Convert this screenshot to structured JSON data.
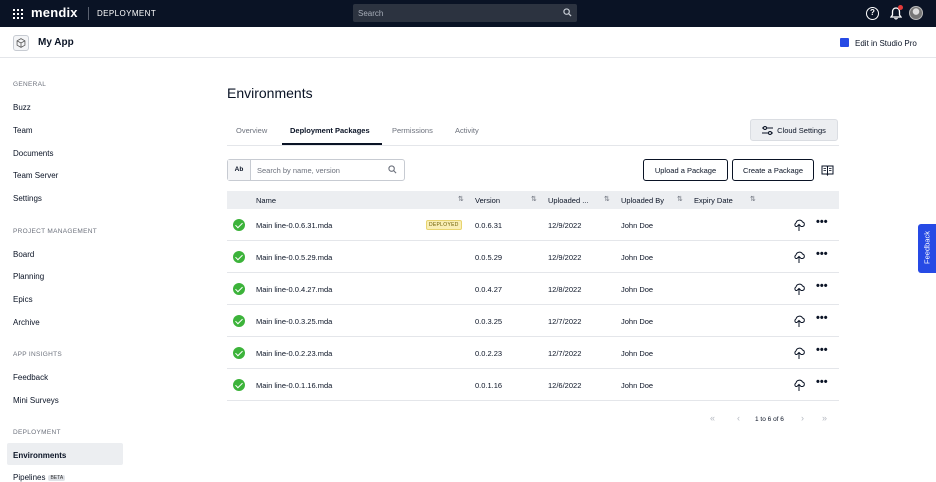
{
  "topbar": {
    "brand": "mendix",
    "section": "DEPLOYMENT",
    "search_placeholder": "Search"
  },
  "app": {
    "name": "My App",
    "studio_link": "Edit in Studio Pro"
  },
  "sidebar": {
    "sections": [
      {
        "title": "GENERAL",
        "items": [
          "Buzz",
          "Team",
          "Documents",
          "Team Server",
          "Settings"
        ]
      },
      {
        "title": "PROJECT MANAGEMENT",
        "items": [
          "Board",
          "Planning",
          "Epics",
          "Archive"
        ]
      },
      {
        "title": "APP INSIGHTS",
        "items": [
          "Feedback",
          "Mini Surveys"
        ]
      },
      {
        "title": "DEPLOYMENT",
        "items": [
          "Environments",
          "Pipelines"
        ]
      }
    ],
    "active_item": "Environments",
    "beta_badge": "BETA"
  },
  "main": {
    "title": "Environments",
    "tabs": [
      "Overview",
      "Deployment Packages",
      "Permissions",
      "Activity"
    ],
    "active_tab": "Deployment Packages",
    "cloud_settings": "Cloud Settings",
    "search_prefix": "Ab",
    "search_placeholder": "Search by name, version",
    "upload_button": "Upload a Package",
    "create_button": "Create a Package"
  },
  "table": {
    "headers": {
      "name": "Name",
      "version": "Version",
      "uploaded": "Uploaded ...",
      "uploaded_by": "Uploaded By",
      "expiry": "Expiry Date"
    },
    "rows": [
      {
        "name": "Main line-0.0.6.31.mda",
        "version": "0.0.6.31",
        "uploaded": "12/9/2022",
        "uploaded_by": "John Doe",
        "badge": "DEPLOYED"
      },
      {
        "name": "Main line-0.0.5.29.mda",
        "version": "0.0.5.29",
        "uploaded": "12/9/2022",
        "uploaded_by": "John Doe",
        "badge": ""
      },
      {
        "name": "Main line-0.0.4.27.mda",
        "version": "0.0.4.27",
        "uploaded": "12/8/2022",
        "uploaded_by": "John Doe",
        "badge": ""
      },
      {
        "name": "Main line-0.0.3.25.mda",
        "version": "0.0.3.25",
        "uploaded": "12/7/2022",
        "uploaded_by": "John Doe",
        "badge": ""
      },
      {
        "name": "Main line-0.0.2.23.mda",
        "version": "0.0.2.23",
        "uploaded": "12/7/2022",
        "uploaded_by": "John Doe",
        "badge": ""
      },
      {
        "name": "Main line-0.0.1.16.mda",
        "version": "0.0.1.16",
        "uploaded": "12/6/2022",
        "uploaded_by": "John Doe",
        "badge": ""
      }
    ],
    "row_menu": "•••"
  },
  "pagination": {
    "info": "1 to 6 of 6",
    "first": "«",
    "prev": "‹",
    "next": "›",
    "last": "»"
  },
  "feedback_tab": "Feedback",
  "colors": {
    "topbar": "#0a1325",
    "accent": "#264ae5",
    "success": "#3cb33a",
    "deployed_badge": "#f9eeb5"
  }
}
